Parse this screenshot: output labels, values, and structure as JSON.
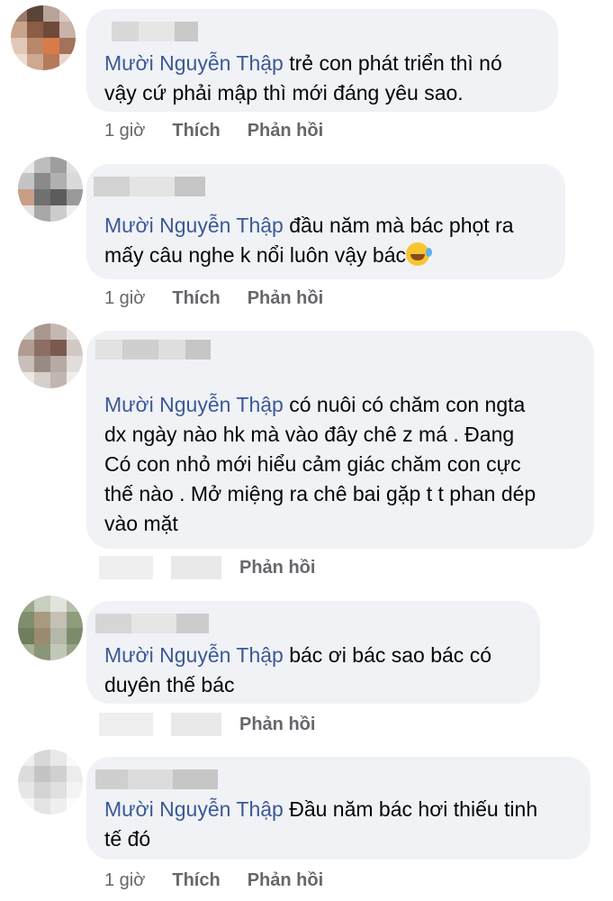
{
  "comments": [
    {
      "author": "Mười Nguyễn Thập",
      "text": " trẻ con phát triển thì nó\nvậy cứ phải mập thì mới đáng yêu sao.",
      "time": "1 giờ",
      "like": "Thích",
      "reply": "Phản hồi"
    },
    {
      "author": "Mười Nguyễn Thập",
      "text": " đầu năm mà bác phọt ra\nmấy câu nghe k nổi luôn vậy bác",
      "time": "1 giờ",
      "like": "Thích",
      "reply": "Phản hồi"
    },
    {
      "author": "Mười Nguyễn Thập",
      "text": " có nuôi có chăm con ngta\ndx ngày nào hk mà vào đây chê z má . Đang\nCó con nhỏ mới hiểu cảm giác chăm con cực\nthế nào . Mở miệng ra chê bai gặp t t phan dép\nvào mặt",
      "reply": "Phản hồi"
    },
    {
      "author": "Mười Nguyễn Thập",
      "text": " bác ơi bác sao bác có\nduyên thế bác",
      "reply": "Phản hồi"
    },
    {
      "author": "Mười Nguyễn Thập",
      "text": " Đầu năm bác hơi thiếu tinh\ntế đó",
      "time": "1 giờ",
      "like": "Thích",
      "reply": "Phản hồi"
    }
  ],
  "colors": {
    "bubble": "#f0f2f5",
    "author": "#3b5998",
    "meta": "#65676b",
    "text": "#050505"
  },
  "icons": [
    "blurred-avatar",
    "rofl-emoji-icon"
  ]
}
